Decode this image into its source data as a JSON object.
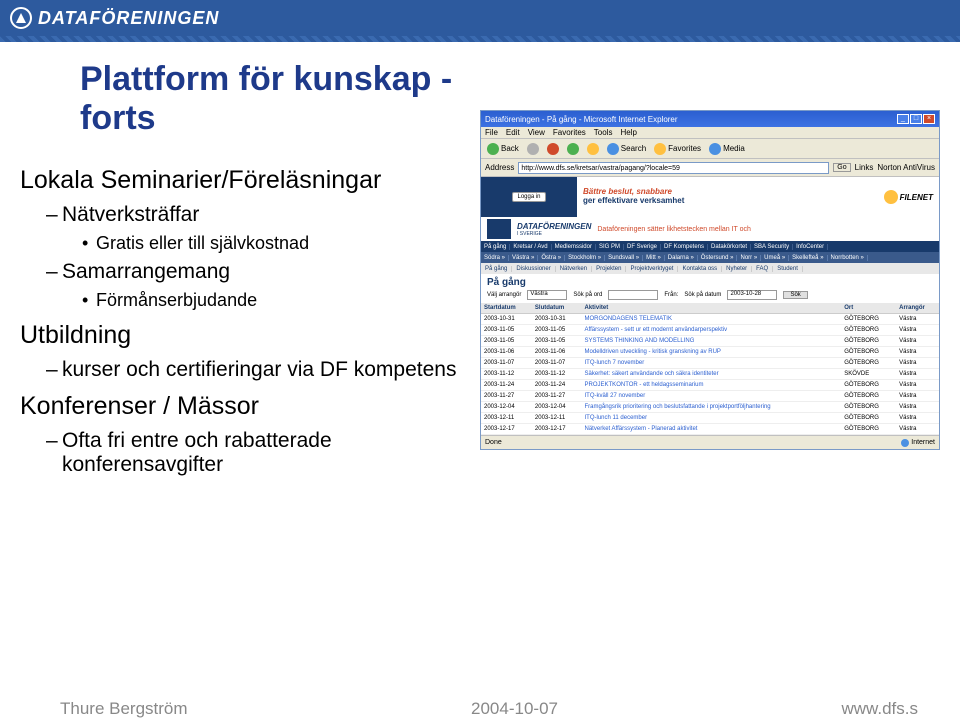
{
  "header": {
    "logo_text": "DATAFÖRENINGEN"
  },
  "slide": {
    "title": "Plattform för kunskap - forts",
    "sections": [
      {
        "heading": "Lokala Seminarier/Föreläsningar",
        "items": [
          {
            "text": "Nätverksträffar",
            "sub": [
              "Gratis eller till självkostnad"
            ]
          },
          {
            "text": "Samarrangemang",
            "sub": [
              "Förmånserbjudande"
            ]
          }
        ]
      },
      {
        "heading": "Utbildning",
        "items": [
          {
            "text": "kurser och certifieringar via DF kompetens",
            "sub": []
          }
        ]
      },
      {
        "heading": "Konferenser / Mässor",
        "items": [
          {
            "text": "Ofta fri entre och rabatterade konferensavgifter",
            "sub": []
          }
        ]
      }
    ]
  },
  "browser": {
    "title": "Dataföreningen - På gång - Microsoft Internet Explorer",
    "menu": [
      "File",
      "Edit",
      "View",
      "Favorites",
      "Tools",
      "Help"
    ],
    "toolbar": {
      "back": "Back",
      "search": "Search",
      "favorites": "Favorites",
      "media": "Media"
    },
    "address_label": "Address",
    "address_url": "http://www.dfs.se/kretsar/vastra/pagang/?locale=59",
    "go": "Go",
    "links": "Links",
    "norton": "Norton AntiVirus",
    "login": "Logga in",
    "slogan_l1": "Bättre beslut, snabbare",
    "slogan_l2": "ger effektivare verksamhet",
    "filenet": "FILENET",
    "df_brand": "DATAFÖRENINGEN",
    "df_sub": "I SVERIGE",
    "df_tag": "Dataföreningen sätter likhetstecken mellan IT och",
    "nav1": [
      "På gång",
      "Kretsar / Avd",
      "Medlemssidor",
      "SIG PM",
      "DF Sverige",
      "DF Kompetens",
      "Datakörkortet",
      "SBA Security",
      "InfoCenter"
    ],
    "nav2": [
      "Södra »",
      "Västra »",
      "Östra »",
      "Stockholm »",
      "Sundsvall »",
      "Mitt »",
      "Dalarna »",
      "Östersund »",
      "Norr »",
      "Umeå »",
      "Skellefteå »",
      "Norrbotten »"
    ],
    "nav3": [
      "På gång",
      "Diskussioner",
      "Nätverken",
      "Projekten",
      "Projektverktyget",
      "Kontakta oss",
      "Nyheter",
      "FAQ",
      "Student"
    ],
    "pa_gang": "På gång",
    "search": {
      "valj": "Välj arrangör",
      "valj_val": "Västra",
      "sok_ord": "Sök på ord",
      "fran": "Från:",
      "sok_datum": "Sök på datum",
      "datum_val": "2003-10-28",
      "sok_btn": "Sök"
    },
    "cols": {
      "start": "Startdatum",
      "slut": "Slutdatum",
      "akt": "Aktivitet",
      "ort": "Ort",
      "arr": "Arrangör"
    },
    "events": [
      {
        "s": "2003-10-31",
        "e": "2003-10-31",
        "a": "MORGONDAGENS TELEMATIK",
        "o": "GÖTEBORG",
        "r": "Västra"
      },
      {
        "s": "2003-11-05",
        "e": "2003-11-05",
        "a": "Affärssystem - sett ur ett modernt användarperspektiv",
        "o": "GÖTEBORG",
        "r": "Västra"
      },
      {
        "s": "2003-11-05",
        "e": "2003-11-05",
        "a": "SYSTEMS THINKING AND MODELLING",
        "o": "GÖTEBORG",
        "r": "Västra"
      },
      {
        "s": "2003-11-06",
        "e": "2003-11-06",
        "a": "Modelldriven utveckling - kritisk granskning av RUP",
        "o": "GÖTEBORG",
        "r": "Västra"
      },
      {
        "s": "2003-11-07",
        "e": "2003-11-07",
        "a": "ITQ-lunch 7 november",
        "o": "GÖTEBORG",
        "r": "Västra"
      },
      {
        "s": "2003-11-12",
        "e": "2003-11-12",
        "a": "Säkerhet: säkert användande och säkra identiteter",
        "o": "SKÖVDE",
        "r": "Västra"
      },
      {
        "s": "2003-11-24",
        "e": "2003-11-24",
        "a": "PROJEKTKONTOR - ett heldagsseminarium",
        "o": "GÖTEBORG",
        "r": "Västra"
      },
      {
        "s": "2003-11-27",
        "e": "2003-11-27",
        "a": "ITQ-kväll 27 november",
        "o": "GÖTEBORG",
        "r": "Västra"
      },
      {
        "s": "2003-12-04",
        "e": "2003-12-04",
        "a": "Framgångsrik prioritering och beslutsfattande i projektportföljhantering",
        "o": "GÖTEBORG",
        "r": "Västra"
      },
      {
        "s": "2003-12-11",
        "e": "2003-12-11",
        "a": "ITQ-lunch 11 december",
        "o": "GÖTEBORG",
        "r": "Västra"
      },
      {
        "s": "2003-12-17",
        "e": "2003-12-17",
        "a": "Nätverket Affärssystem - Planerad aktivitet",
        "o": "GÖTEBORG",
        "r": "Västra"
      }
    ],
    "status_done": "Done",
    "status_net": "Internet"
  },
  "footer": {
    "left": "Thure Bergström",
    "center": "2004-10-07",
    "right": "www.dfs.s"
  }
}
